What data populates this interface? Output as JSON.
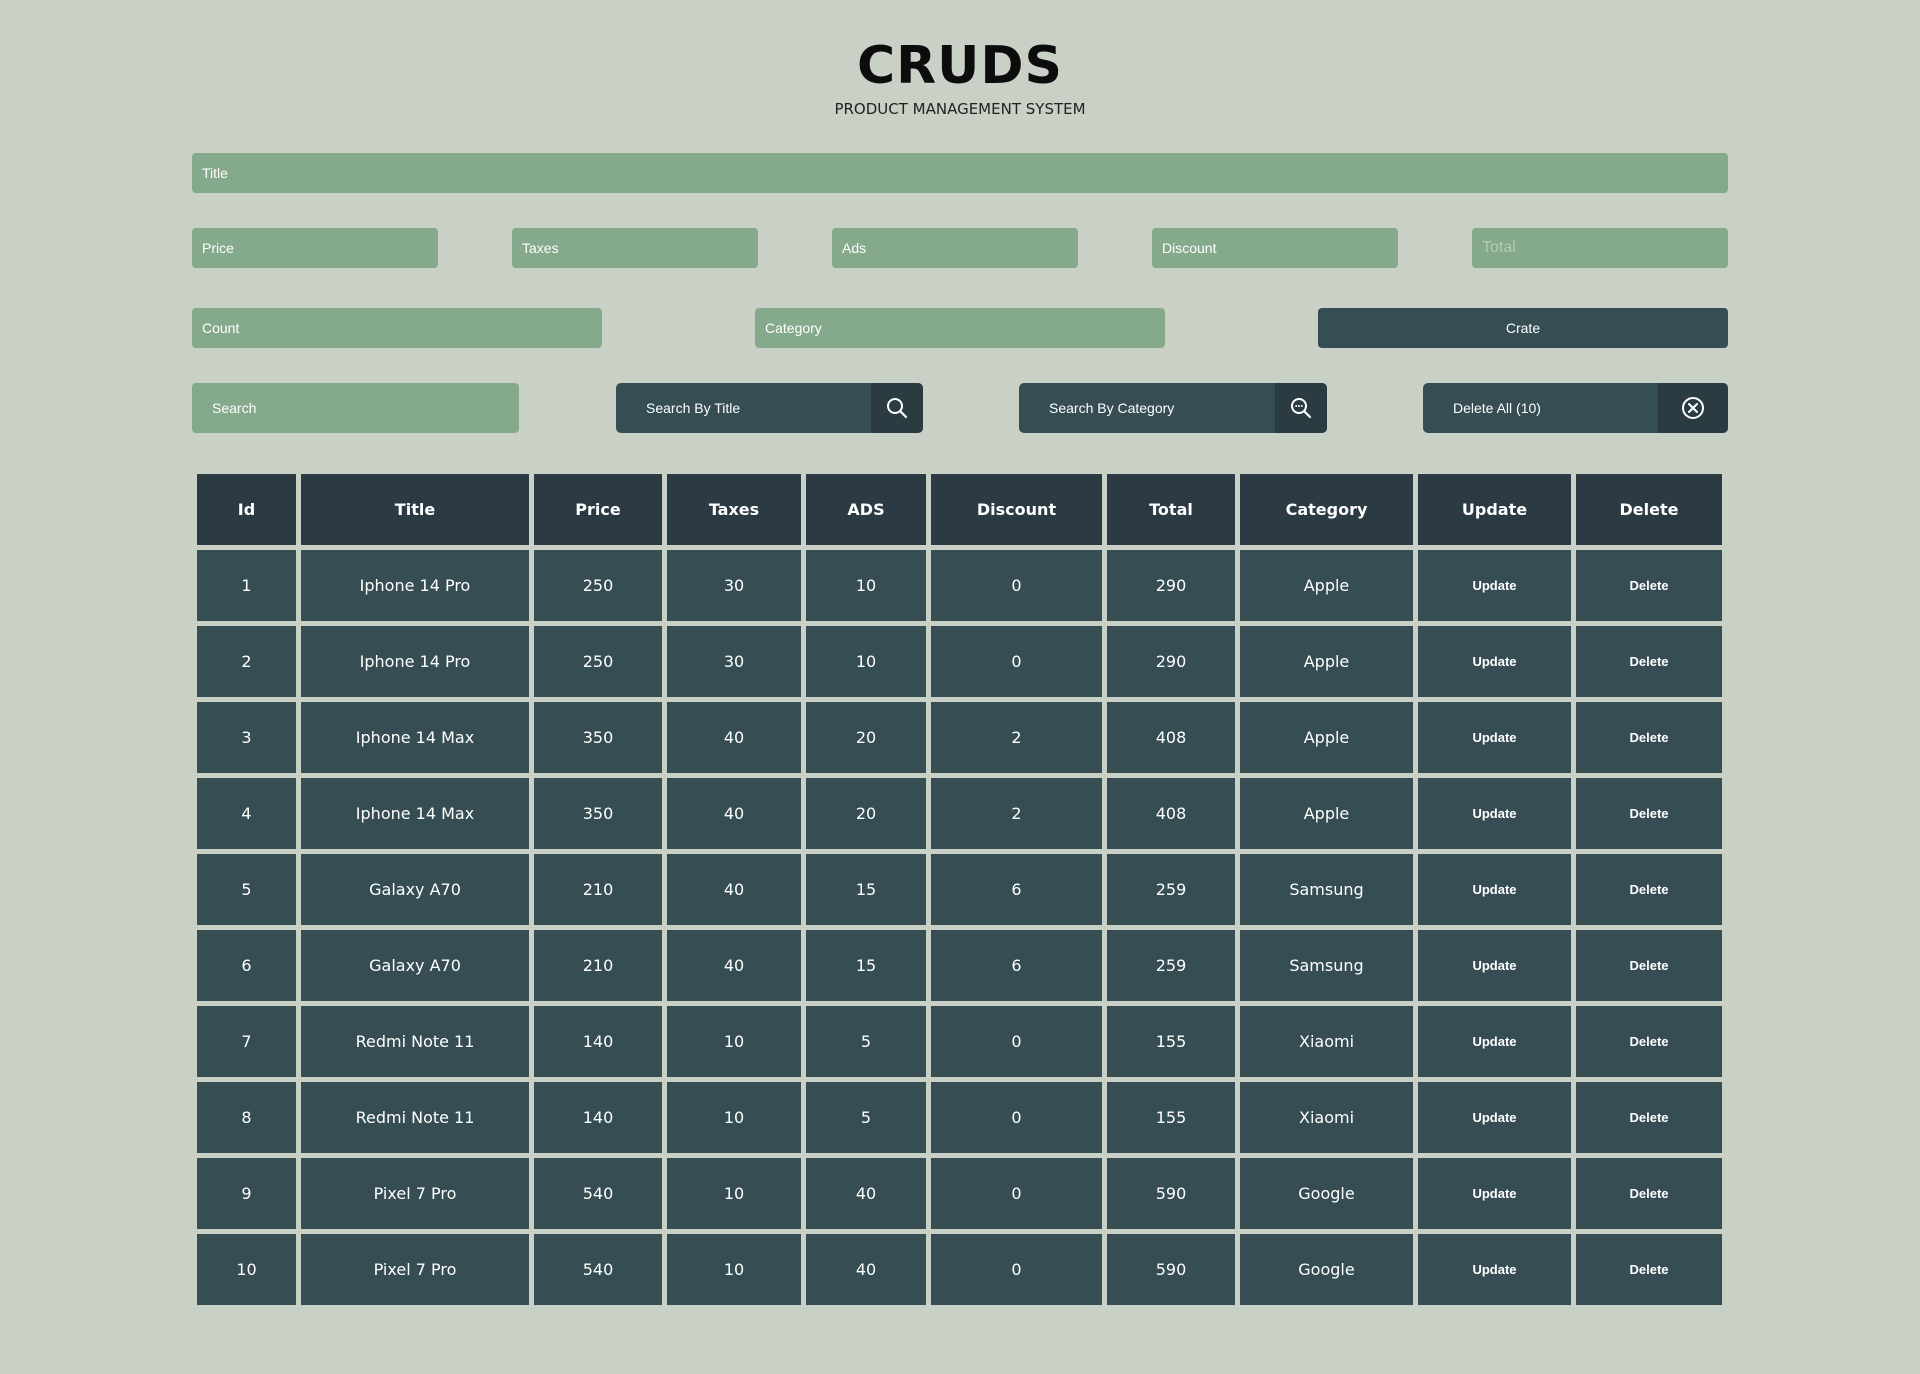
{
  "header": {
    "title": "CRUDS",
    "subtitle": "PRODUCT MANAGEMENT SYSTEM"
  },
  "form": {
    "title_placeholder": "Title",
    "price_placeholder": "Price",
    "taxes_placeholder": "Taxes",
    "ads_placeholder": "Ads",
    "discount_placeholder": "Discount",
    "total_placeholder": "Total",
    "count_placeholder": "Count",
    "category_placeholder": "Category",
    "create_label": "Crate"
  },
  "search": {
    "placeholder": "Search",
    "by_title_label": "Search By Title",
    "by_category_label": "Search By Category",
    "delete_all_label": "Delete All (10)"
  },
  "table": {
    "headers": {
      "id": "Id",
      "title": "Title",
      "price": "Price",
      "taxes": "Taxes",
      "ads": "ADS",
      "discount": "Discount",
      "total": "Total",
      "category": "Category",
      "update": "Update",
      "delete": "Delete"
    },
    "rows": [
      {
        "id": "1",
        "title": "Iphone 14 Pro",
        "price": "250",
        "taxes": "30",
        "ads": "10",
        "discount": "0",
        "total": "290",
        "category": "Apple",
        "update": "Update",
        "delete": "Delete"
      },
      {
        "id": "2",
        "title": "Iphone 14 Pro",
        "price": "250",
        "taxes": "30",
        "ads": "10",
        "discount": "0",
        "total": "290",
        "category": "Apple",
        "update": "Update",
        "delete": "Delete"
      },
      {
        "id": "3",
        "title": "Iphone 14 Max",
        "price": "350",
        "taxes": "40",
        "ads": "20",
        "discount": "2",
        "total": "408",
        "category": "Apple",
        "update": "Update",
        "delete": "Delete"
      },
      {
        "id": "4",
        "title": "Iphone 14 Max",
        "price": "350",
        "taxes": "40",
        "ads": "20",
        "discount": "2",
        "total": "408",
        "category": "Apple",
        "update": "Update",
        "delete": "Delete"
      },
      {
        "id": "5",
        "title": "Galaxy A70",
        "price": "210",
        "taxes": "40",
        "ads": "15",
        "discount": "6",
        "total": "259",
        "category": "Samsung",
        "update": "Update",
        "delete": "Delete"
      },
      {
        "id": "6",
        "title": "Galaxy A70",
        "price": "210",
        "taxes": "40",
        "ads": "15",
        "discount": "6",
        "total": "259",
        "category": "Samsung",
        "update": "Update",
        "delete": "Delete"
      },
      {
        "id": "7",
        "title": "Redmi Note 11",
        "price": "140",
        "taxes": "10",
        "ads": "5",
        "discount": "0",
        "total": "155",
        "category": "Xiaomi",
        "update": "Update",
        "delete": "Delete"
      },
      {
        "id": "8",
        "title": "Redmi Note 11",
        "price": "140",
        "taxes": "10",
        "ads": "5",
        "discount": "0",
        "total": "155",
        "category": "Xiaomi",
        "update": "Update",
        "delete": "Delete"
      },
      {
        "id": "9",
        "title": "Pixel 7 Pro",
        "price": "540",
        "taxes": "10",
        "ads": "40",
        "discount": "0",
        "total": "590",
        "category": "Google",
        "update": "Update",
        "delete": "Delete"
      },
      {
        "id": "10",
        "title": "Pixel 7 Pro",
        "price": "540",
        "taxes": "10",
        "ads": "40",
        "discount": "0",
        "total": "590",
        "category": "Google",
        "update": "Update",
        "delete": "Delete"
      }
    ]
  },
  "icons": {
    "search_title": "search-icon",
    "search_category": "search-comment-icon",
    "delete_all": "close-circle-icon"
  },
  "colors": {
    "background": "#c9d1c6",
    "field": "#85a98b",
    "dark": "#354d53",
    "header_cell": "#2c3a44"
  }
}
